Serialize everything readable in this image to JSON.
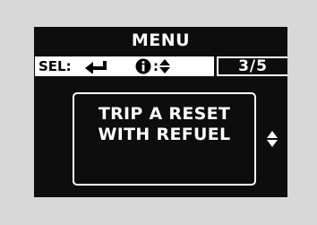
{
  "menu": {
    "title": "MENU"
  },
  "status": {
    "select_label": "SEL:",
    "select_icon": "enter-arrow-icon",
    "info_icon": "info-icon",
    "info_separator": ":",
    "info_nav_icon": "up-down-arrows-icon",
    "page_indicator": "3/5"
  },
  "item": {
    "text": "TRIP A RESET\nWITH REFUEL",
    "scroll_icon": "up-down-arrows-icon"
  },
  "colors": {
    "background": "#d8d8d8",
    "screen": "#0d0d0d",
    "foreground": "#ffffff"
  }
}
